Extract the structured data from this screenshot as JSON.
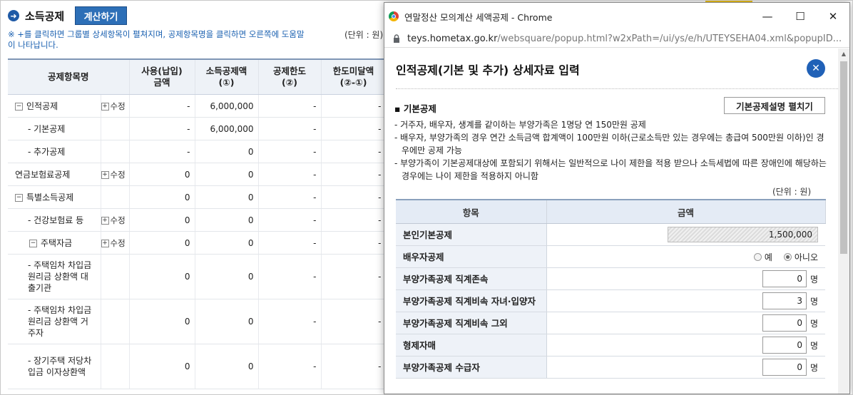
{
  "background": {
    "section_title": "소득공제",
    "calc_button": "계산하기",
    "hint": "※ +를 클릭하면 그룹별 상세항목이 펼쳐지며, 공제항목명을 클릭하면 오른쪽에 도움말이 나타납니다.",
    "unit": "(단위 : 원)",
    "columns": [
      "공제항목명",
      "사용(납입)\n금액",
      "소득공제액\n(①)",
      "공제한도\n(②)",
      "한도미달액\n(②-①)"
    ],
    "edit_label": "수정",
    "rows": [
      {
        "name": "인적공제",
        "toggle": "−",
        "edit": true,
        "use": "-",
        "deduct": "6,000,000",
        "limit": "-",
        "short": "-"
      },
      {
        "name": "- 기본공제",
        "toggle": "",
        "edit": false,
        "use": "-",
        "deduct": "6,000,000",
        "limit": "-",
        "short": "-"
      },
      {
        "name": "- 추가공제",
        "toggle": "",
        "edit": false,
        "use": "-",
        "deduct": "0",
        "limit": "-",
        "short": "-"
      },
      {
        "name": "연금보험료공제",
        "toggle": "",
        "edit": true,
        "use": "0",
        "deduct": "0",
        "limit": "-",
        "short": "-"
      },
      {
        "name": "특별소득공제",
        "toggle": "−",
        "edit": false,
        "use": "0",
        "deduct": "0",
        "limit": "-",
        "short": "-"
      },
      {
        "name": "- 건강보험료 등",
        "toggle": "",
        "edit": true,
        "use": "0",
        "deduct": "0",
        "limit": "-",
        "short": "-"
      },
      {
        "name": "주택자금",
        "toggle": "−",
        "edit": true,
        "use": "0",
        "deduct": "0",
        "limit": "-",
        "short": "-"
      },
      {
        "name": "- 주택임차 차입금 원리금 상환액 대출기관",
        "toggle": "",
        "edit": false,
        "use": "0",
        "deduct": "0",
        "limit": "-",
        "short": "-"
      },
      {
        "name": "- 주택임차 차입금 원리금 상환액 거주자",
        "toggle": "",
        "edit": false,
        "use": "0",
        "deduct": "0",
        "limit": "-",
        "short": "-"
      },
      {
        "name": "- 장기주택 저당차입금 이자상환액",
        "toggle": "",
        "edit": false,
        "use": "0",
        "deduct": "0",
        "limit": "-",
        "short": "-"
      }
    ]
  },
  "popup": {
    "window_title": "연말정산 모의계산 세액공제 - Chrome",
    "url_host": "teys.hometax.go.kr",
    "url_path": "/websquare/popup.html?w2xPath=/ui/ys/e/h/UTEYSEHA04.xml&popupID...",
    "heading": "인적공제(기본 및 추가) 상세자료 입력",
    "subheading": "기본공제",
    "expand_button": "기본공제설명 펼치기",
    "notes": [
      "- 거주자, 배우자, 생계를 같이하는 부양가족은 1명당 연 150만원 공제",
      "- 배우자, 부양가족의 경우 연간 소득금액 합계액이 100만원 이하(근로소득만 있는 경우에는 총급여 500만원 이하)인 경우에만 공제 가능",
      "- 부양가족이 기본공제대상에 포함되기 위해서는 일반적으로 나이 제한을 적용 받으나 소득세법에 따른 장애인에 해당하는 경우에는 나이 제한을 적용하지 아니함"
    ],
    "unit": "(단위 : 원)",
    "table_headers": [
      "항목",
      "금액"
    ],
    "self_deduction": {
      "label": "본인기본공제",
      "value": "1,500,000"
    },
    "spouse": {
      "label": "배우자공제",
      "yes": "예",
      "no": "아니오",
      "selected": "아니오"
    },
    "dependents": [
      {
        "label": "부양가족공제 직계존속",
        "value": "0",
        "unit": "명"
      },
      {
        "label": "부양가족공제 직계비속 자녀·입양자",
        "value": "3",
        "unit": "명"
      },
      {
        "label": "부양가족공제 직계비속 그외",
        "value": "0",
        "unit": "명"
      },
      {
        "label": "형제자매",
        "value": "0",
        "unit": "명"
      },
      {
        "label": "부양가족공제 수급자",
        "value": "0",
        "unit": "명"
      }
    ]
  }
}
